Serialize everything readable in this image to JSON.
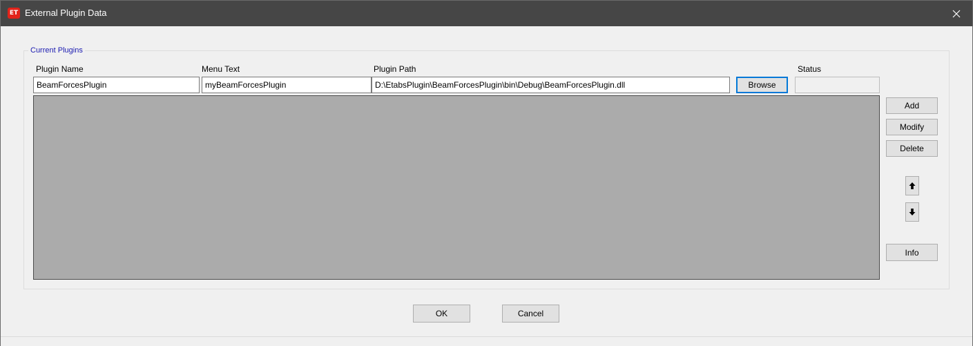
{
  "window": {
    "app_icon_text": "ET",
    "title": "External Plugin Data",
    "close_glyph": "✕"
  },
  "group": {
    "legend": "Current Plugins"
  },
  "columns": {
    "plugin_name": "Plugin Name",
    "menu_text": "Menu Text",
    "plugin_path": "Plugin Path",
    "status": "Status"
  },
  "row": {
    "plugin_name_value": "BeamForcesPlugin",
    "menu_text_value": "myBeamForcesPlugin",
    "plugin_path_value": "D:\\EtabsPlugin\\BeamForcesPlugin\\bin\\Debug\\BeamForcesPlugin.dll",
    "browse_label": "Browse"
  },
  "side_buttons": {
    "add": "Add",
    "modify": "Modify",
    "delete": "Delete",
    "info": "Info"
  },
  "icons": {
    "move_up": "arrow-up-icon",
    "move_down": "arrow-down-icon",
    "close": "close-icon"
  },
  "footer": {
    "ok": "OK",
    "cancel": "Cancel"
  },
  "colors": {
    "titlebar": "#464646",
    "app_icon": "#e2231a",
    "legend_text": "#1a1ab0",
    "list_background": "#ababab",
    "focus_border": "#0078d7"
  }
}
